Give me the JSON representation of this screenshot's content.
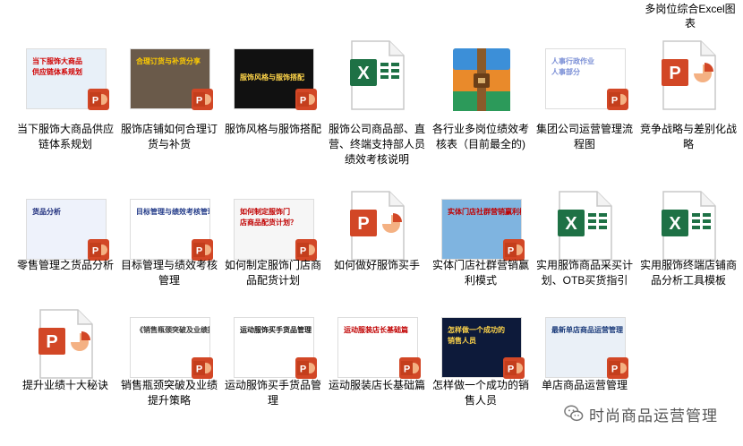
{
  "header_tail": "多岗位综合Excel图表",
  "colors": {
    "ppt_orange": "#d24726",
    "ppt_light": "#f4b183",
    "excel_green": "#1e7145",
    "doc_border": "#c8c8c8"
  },
  "rows": [
    [
      {
        "label": "当下服饰大商品供应链体系规划",
        "thumb": "image",
        "caption": "当下服饰大商品\n供应链体系规划",
        "bg": "#e8f0f8",
        "capColor": "#d00000"
      },
      {
        "label": "服饰店铺如何合理订货与补货",
        "thumb": "image",
        "caption": "合理订货与补货分享",
        "bg": "#6a5a4a",
        "capColor": "#ffcc00"
      },
      {
        "label": "服饰风格与服饰搭配",
        "thumb": "image",
        "caption": "服饰风格与服饰搭配",
        "bg": "#111111",
        "capColor": "#ffd54a"
      },
      {
        "label": "服饰公司商品部、直营、终端支持部人员绩效考核说明",
        "thumb": "excel"
      },
      {
        "label": "各行业多岗位绩效考核表（目前最全的)",
        "thumb": "archive"
      },
      {
        "label": "集团公司运营管理流程图",
        "thumb": "image",
        "caption": "人事行政作业\n人事部分",
        "bg": "#ffffff",
        "capColor": "#7b8fd6"
      },
      {
        "label": "竞争战略与差别化战略",
        "thumb": "ppt"
      }
    ],
    [
      {
        "label": "零售管理之货品分析",
        "thumb": "image",
        "caption": "货品分析",
        "bg": "#eef2fb",
        "capColor": "#1a2a7a"
      },
      {
        "label": "目标管理与绩效考核管理",
        "thumb": "image",
        "caption": "目标管理与绩效考核管理",
        "bg": "#ffffff",
        "capColor": "#223a88"
      },
      {
        "label": "如何制定服饰门店商品配货计划",
        "thumb": "image",
        "caption": "如何制定服饰门\n店商品配货计划？",
        "bg": "#f6f6f6",
        "capColor": "#c00000"
      },
      {
        "label": "如何做好服饰买手",
        "thumb": "ppt"
      },
      {
        "label": "实体门店社群营销赢利模式",
        "thumb": "image",
        "caption": "实体门店社群营销赢利模式",
        "bg": "#7fb4e0",
        "capColor": "#c00000"
      },
      {
        "label": "实用服饰商品采买计划、OTB买货指引",
        "thumb": "excel"
      },
      {
        "label": "实用服饰终端店铺商品分析工具模板",
        "thumb": "excel"
      }
    ],
    [
      {
        "label": "提升业绩十大秘诀",
        "thumb": "ppt"
      },
      {
        "label": "销售瓶颈突破及业绩提升策略",
        "thumb": "image",
        "caption": "《销售瓶颈突破及业绩提升策略》",
        "bg": "#ffffff",
        "capColor": "#333333"
      },
      {
        "label": "运动服饰买手货品管理",
        "thumb": "image",
        "caption": "运动服饰买手货品管理",
        "bg": "#ffffff",
        "capColor": "#111111"
      },
      {
        "label": "运动服装店长基础篇",
        "thumb": "image",
        "caption": "运动服装店长基础篇",
        "bg": "#ffffff",
        "capColor": "#c00000"
      },
      {
        "label": "怎样做一个成功的销售人员",
        "thumb": "image",
        "caption": "怎样做一个成功的\n销售人员",
        "bg": "#0d1a3a",
        "capColor": "#ffd54a"
      },
      {
        "label": "单店商品运营管理",
        "thumb": "image",
        "caption": "最新单店商品运营管理",
        "bg": "#eaf0f7",
        "capColor": "#1a3a7a"
      }
    ]
  ],
  "watermark": "时尚商品运营管理"
}
